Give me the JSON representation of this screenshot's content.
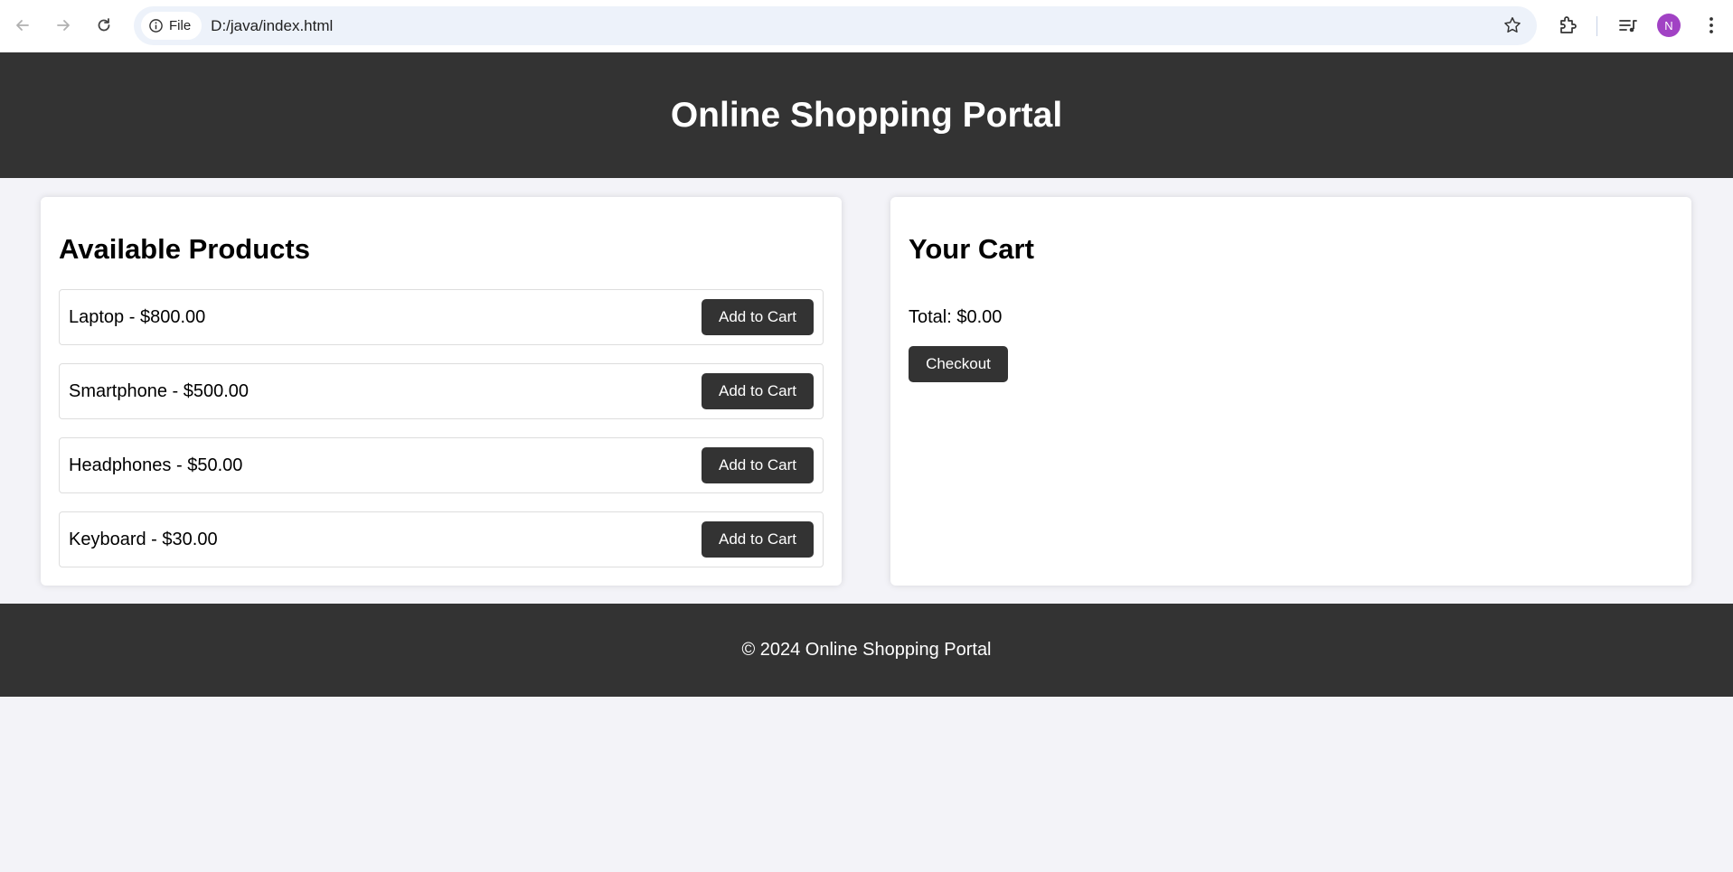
{
  "browser": {
    "file_chip_label": "File",
    "url": "D:/java/index.html",
    "profile_initial": "N"
  },
  "header": {
    "title": "Online Shopping Portal"
  },
  "products": {
    "heading": "Available Products",
    "add_label": "Add to Cart",
    "items": [
      {
        "label": "Laptop - $800.00"
      },
      {
        "label": "Smartphone - $500.00"
      },
      {
        "label": "Headphones - $50.00"
      },
      {
        "label": "Keyboard - $30.00"
      }
    ]
  },
  "cart": {
    "heading": "Your Cart",
    "total": "Total: $0.00",
    "checkout_label": "Checkout"
  },
  "footer": {
    "text": "© 2024 Online Shopping Portal"
  },
  "colors": {
    "dark": "#333333",
    "page_bg": "#f3f3f8",
    "avatar": "#a142c4"
  }
}
